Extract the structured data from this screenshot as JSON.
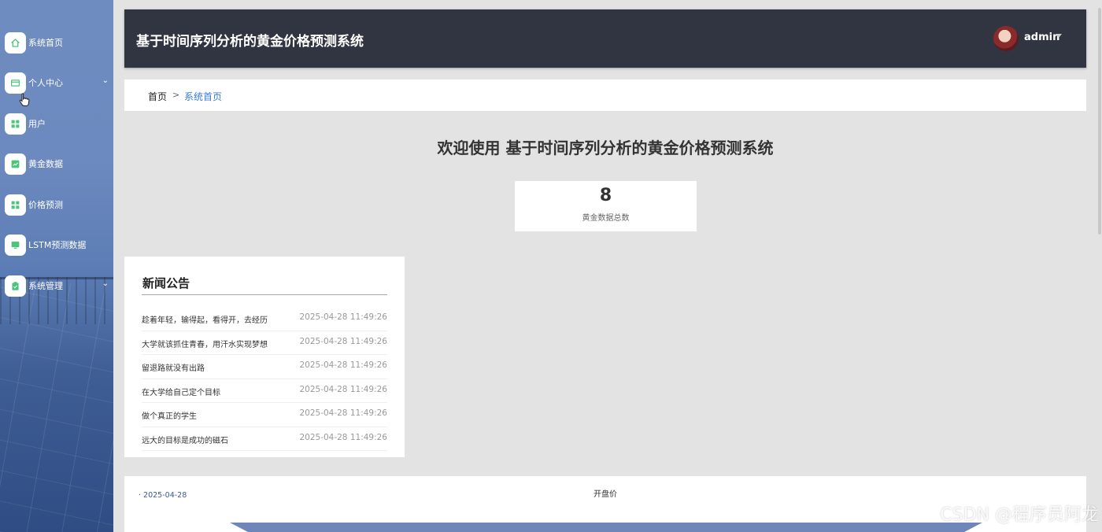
{
  "sidebar": {
    "items": [
      {
        "label": "系统首页",
        "icon": "home-icon",
        "has_children": false
      },
      {
        "label": "个人中心",
        "icon": "card-icon",
        "has_children": true
      },
      {
        "label": "用户",
        "icon": "grid-icon",
        "has_children": false
      },
      {
        "label": "黄金数据",
        "icon": "chart-icon",
        "has_children": false
      },
      {
        "label": "价格预测",
        "icon": "grid-icon",
        "has_children": false
      },
      {
        "label": "LSTM预测数据",
        "icon": "monitor-icon",
        "has_children": false
      },
      {
        "label": "系统管理",
        "icon": "clipboard-icon",
        "has_children": true
      }
    ],
    "icon_color": "#4cc47a"
  },
  "header": {
    "title": "基于时间序列分析的黄金价格预测系统",
    "user": "admin"
  },
  "breadcrumb": {
    "home": "首页",
    "separator": ">",
    "current": "系统首页"
  },
  "welcome": "欢迎使用 基于时间序列分析的黄金价格预测系统",
  "stat": {
    "value": "8",
    "label": "黄金数据总数"
  },
  "news": {
    "title": "新闻公告",
    "items": [
      {
        "text": "趁着年轻，输得起，看得开，去经历",
        "date": "2025-04-28 11:49:26"
      },
      {
        "text": "大学就该抓住青春，用汗水实现梦想",
        "date": "2025-04-28 11:49:26"
      },
      {
        "text": "留退路就没有出路",
        "date": "2025-04-28 11:49:26"
      },
      {
        "text": "在大学给自己定个目标",
        "date": "2025-04-28 11:49:26"
      },
      {
        "text": "做个真正的学生",
        "date": "2025-04-28 11:49:26"
      },
      {
        "text": "远大的目标是成功的磁石",
        "date": "2025-04-28 11:49:26"
      }
    ]
  },
  "chart": {
    "title": "开盘价",
    "legend": "2025-04-28"
  },
  "watermark": "CSDN @程序员阿龙",
  "colors": {
    "header_bg": "#313441",
    "breadcrumb_active": "#3a7bd5",
    "page_bg": "#e3e3e3"
  }
}
